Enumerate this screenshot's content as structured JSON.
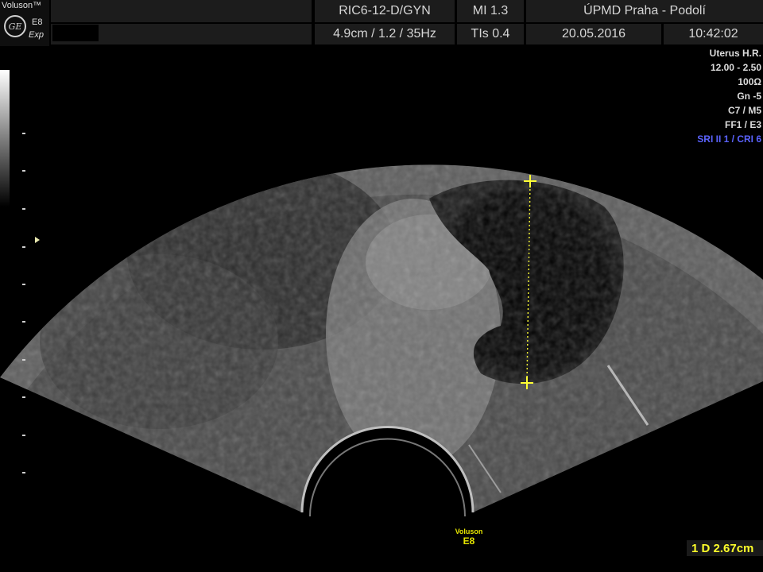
{
  "header": {
    "brand": "Voluson™",
    "logo_text": "GE",
    "model": "E8",
    "mode": "Exp",
    "probe": "RIC6-12-D/GYN",
    "depth_info": "4.9cm / 1.2 / 35Hz",
    "mi": "MI  1.3",
    "tis": "TIs  0.4",
    "institution": "ÚPMD Praha - Podolí",
    "date": "20.05.2016",
    "time": "10:42:02"
  },
  "params": [
    {
      "text": "Uterus H.R."
    },
    {
      "text": "12.00 - 2.50"
    },
    {
      "text": "100Ω"
    },
    {
      "text": "Gn  -5"
    },
    {
      "text": "C7 / M5"
    },
    {
      "text": "FF1 / E3"
    },
    {
      "text": "SRI II 1 / CRI 6",
      "highlight": true
    }
  ],
  "footer": {
    "line1": "Voluson",
    "line2": "E8"
  },
  "measurement": {
    "text": "1  D 2.67cm",
    "value_cm": 2.67
  },
  "colors": {
    "caliper": "#ffff33",
    "highlight": "#5b63ff",
    "panel": "#1c1c1c"
  },
  "icons": {
    "caliper": "plus-icon",
    "focus": "triangle-right-icon"
  }
}
